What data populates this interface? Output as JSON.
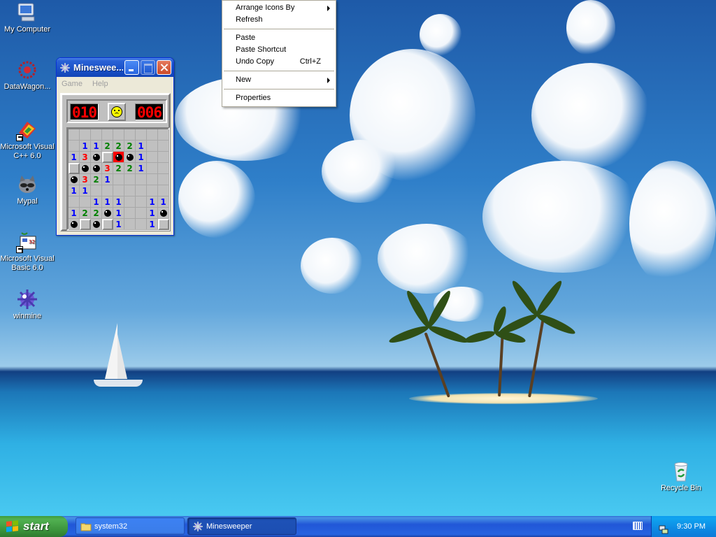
{
  "desktop": {
    "icons": [
      {
        "label": "My Computer",
        "icon": "computer-icon"
      },
      {
        "label": "DataWagon...",
        "icon": "datawagon-icon"
      },
      {
        "label": "Microsoft Visual C++ 6.0",
        "icon": "visual-cpp-icon"
      },
      {
        "label": "Mypal",
        "icon": "mypal-raccoon-icon"
      },
      {
        "label": "Microsoft Visual Basic 6.0",
        "icon": "visual-basic-icon"
      },
      {
        "label": "winmine",
        "icon": "winmine-icon"
      },
      {
        "label": "Recycle Bin",
        "icon": "recycle-bin-icon"
      }
    ]
  },
  "minesweeper": {
    "title": "Minesweeper",
    "title_shown": "Minesweе...",
    "menu": [
      "Game",
      "Help"
    ],
    "mine_counter": "010",
    "timer": "006",
    "face": "sad",
    "grid": [
      [
        "",
        "",
        "",
        "",
        "",
        "",
        "",
        "",
        ""
      ],
      [
        "",
        "1",
        "1",
        "2",
        "2",
        "2",
        "1",
        "",
        ""
      ],
      [
        "1",
        "3",
        "M",
        "C",
        "X",
        "M",
        "1",
        "",
        ""
      ],
      [
        "C",
        "M",
        "M",
        "3",
        "2",
        "2",
        "1",
        "",
        ""
      ],
      [
        "M",
        "3",
        "2",
        "1",
        "",
        "",
        "",
        "",
        ""
      ],
      [
        "1",
        "1",
        "",
        "",
        "",
        "",
        "",
        "",
        ""
      ],
      [
        "",
        "",
        "1",
        "1",
        "1",
        "",
        "",
        "1",
        "1"
      ],
      [
        "1",
        "2",
        "2",
        "M",
        "1",
        "",
        "",
        "1",
        "M"
      ],
      [
        "M",
        "C",
        "M",
        "C",
        "1",
        "",
        "",
        "1",
        "C"
      ]
    ]
  },
  "context_menu": {
    "items": [
      {
        "label": "Arrange Icons By",
        "submenu": true
      },
      {
        "label": "Refresh"
      },
      {
        "separator": true
      },
      {
        "label": "Paste"
      },
      {
        "label": "Paste Shortcut"
      },
      {
        "label": "Undo Copy",
        "shortcut": "Ctrl+Z"
      },
      {
        "separator": true
      },
      {
        "label": "New",
        "submenu": true
      },
      {
        "separator": true
      },
      {
        "label": "Properties"
      }
    ]
  },
  "taskbar": {
    "start_label": "start",
    "tasks": [
      {
        "label": "system32",
        "icon": "folder-icon",
        "active": false
      },
      {
        "label": "Minesweeper",
        "icon": "minesweeper-icon",
        "active": true
      }
    ],
    "clock": "9:30 PM"
  },
  "colors": {
    "xp_blue": "#2157d7",
    "start_green": "#3a923a",
    "lcd_red": "#ff0000"
  }
}
